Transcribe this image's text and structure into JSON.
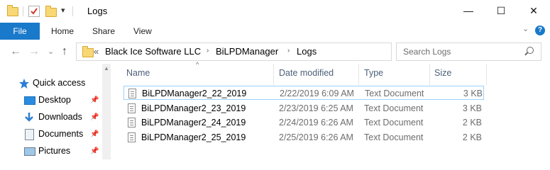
{
  "window": {
    "title": "Logs",
    "controls": {
      "minimize": "—",
      "maximize": "☐",
      "close": "✕"
    }
  },
  "quick_access_toolbar": {
    "dropdown_glyph": "▾"
  },
  "ribbon": {
    "file_tab": "File",
    "tabs": [
      "Home",
      "Share",
      "View"
    ],
    "expand_glyph": "⌄",
    "help_glyph": "?"
  },
  "address_bar": {
    "overflow": "«",
    "breadcrumbs": [
      "Black Ice Software LLC",
      "BiLPDManager",
      "Logs"
    ],
    "separator": "›",
    "dropdown_glyph": "⌄",
    "refresh_glyph": "↻"
  },
  "nav_buttons": {
    "back": "←",
    "forward": "→",
    "recent": "⌄",
    "up": "↑"
  },
  "search": {
    "placeholder": "Search Logs"
  },
  "navigation_pane": {
    "quick_access": "Quick access",
    "items": [
      "Desktop",
      "Downloads",
      "Documents",
      "Pictures"
    ],
    "pin_glyph": "📌"
  },
  "columns": {
    "name": "Name",
    "date_modified": "Date modified",
    "type": "Type",
    "size": "Size",
    "sort_glyph": "^"
  },
  "files": [
    {
      "name": "BiLPDManager2_22_2019",
      "date": "2/22/2019 6:09 AM",
      "type": "Text Document",
      "size": "3 KB"
    },
    {
      "name": "BiLPDManager2_23_2019",
      "date": "2/23/2019 6:25 AM",
      "type": "Text Document",
      "size": "3 KB"
    },
    {
      "name": "BiLPDManager2_24_2019",
      "date": "2/24/2019 6:26 AM",
      "type": "Text Document",
      "size": "2 KB"
    },
    {
      "name": "BiLPDManager2_25_2019",
      "date": "2/25/2019 6:26 AM",
      "type": "Text Document",
      "size": "2 KB"
    }
  ],
  "colors": {
    "accent": "#1979ca",
    "selection_border": "#99d1ff",
    "folder": "#f8d775"
  }
}
